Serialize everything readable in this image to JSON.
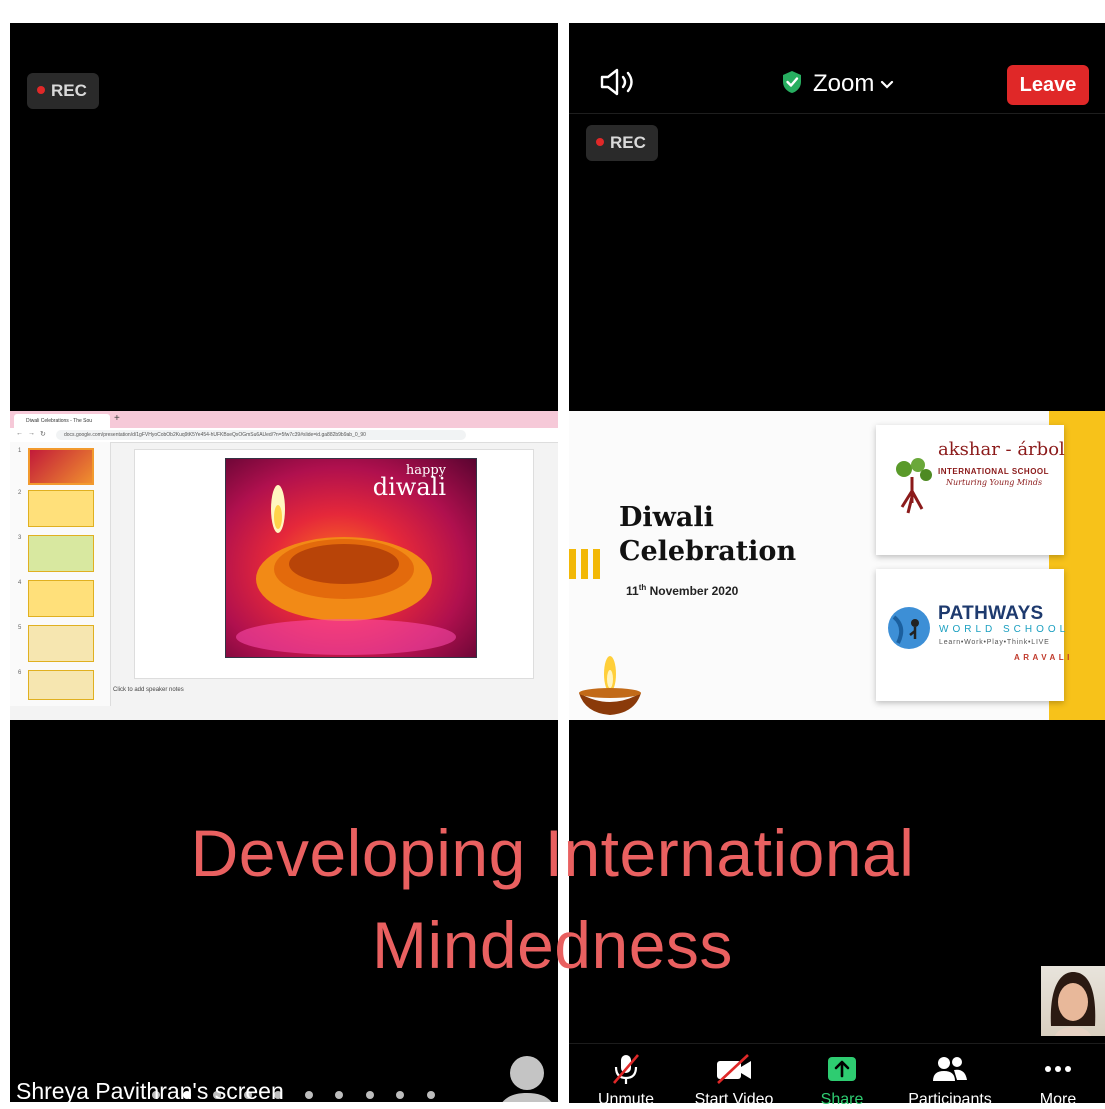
{
  "left_panel": {
    "rec_label": "REC",
    "shared_screen": {
      "tab_title": "Diwali Celebrations - The Sou",
      "url": "docs.google.com/presentation/d/1gFVHyoCobOb2Kuq9tK5Ye454-hUFKBseQxOGmSu6AUed/?n=5fw7c39#slide=id.ga882b9b9ab_0_90",
      "slide_text_happy": "happy",
      "slide_text_diwali": "diwali",
      "speaker_notes": "Click to add speaker notes",
      "thumb_numbers": [
        "1",
        "2",
        "3",
        "4",
        "5",
        "6"
      ]
    },
    "screen_label": "Shreya Pavithran's screen",
    "pager": {
      "total": 10,
      "active_index": 1
    }
  },
  "right_panel": {
    "meeting_title": "Zoom",
    "leave_label": "Leave",
    "rec_label": "REC",
    "slide": {
      "title_line1": "Diwali",
      "title_line2": "Celebration",
      "date_day": "11",
      "date_suffix": "th",
      "date_rest": " November 2020",
      "akshar_name": "akshar - árbol",
      "akshar_sub": "INTERNATIONAL SCHOOL",
      "akshar_tagline": "Nurturing Young Minds",
      "pathways_name": "PATHWAYS",
      "pathways_sub": "WORLD SCHOOL",
      "pathways_tag": "Learn•Work•Play•Think•LIVE",
      "pathways_loc": "ARAVALI"
    }
  },
  "caption": {
    "line1": "Developing International",
    "line2": "Mindedness"
  },
  "toolbar": {
    "unmute": "Unmute",
    "start_video": "Start Video",
    "share": "Share",
    "participants": "Participants",
    "more": "More"
  },
  "colors": {
    "leave_red": "#e02828",
    "caption": "#e96060",
    "share_green": "#2ecc71",
    "slide_yellow": "#f7c21a"
  }
}
